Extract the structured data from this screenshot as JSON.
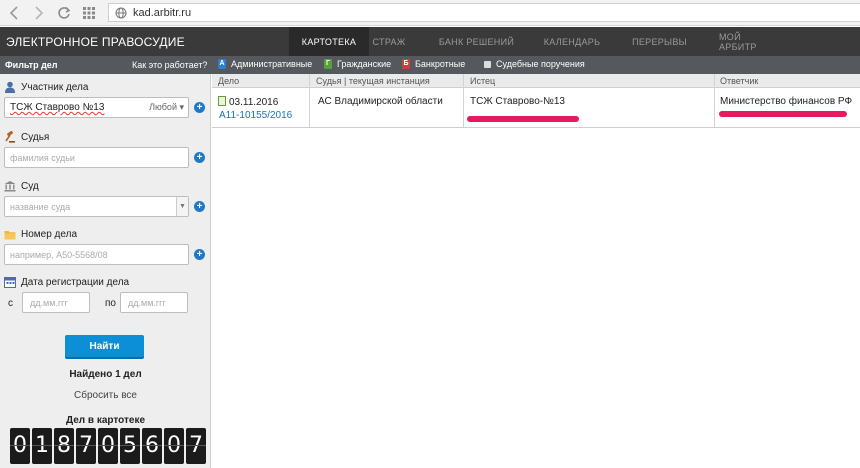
{
  "browser": {
    "url": "kad.arbitr.ru"
  },
  "header": {
    "logo": "ЭЛЕКТРОННОЕ ПРАВОСУДИЕ",
    "tabs": [
      {
        "label": "КАРТОТЕКА",
        "active": true
      },
      {
        "label": "СТРАЖ",
        "active": false
      },
      {
        "label": "БАНК РЕШЕНИЙ",
        "active": false
      },
      {
        "label": "КАЛЕНДАРЬ",
        "active": false
      },
      {
        "label": "ПЕРЕРЫВЫ",
        "active": false
      },
      {
        "label": "МОЙ АРБИТР",
        "active": false
      }
    ]
  },
  "filter_bar": {
    "title": "Фильтр дел",
    "how_it_works": "Как это работает?",
    "categories": [
      {
        "icon": "A",
        "label": "Административные",
        "color": "#2d7fd1"
      },
      {
        "icon": "Г",
        "label": "Гражданские",
        "color": "#5aa03a"
      },
      {
        "icon": "Б",
        "label": "Банкротные",
        "color": "#d33b3b"
      },
      {
        "icon": "",
        "label": "Судебные поручения",
        "color": "#dddddd"
      }
    ]
  },
  "sidebar": {
    "participant": {
      "label": "Участник дела",
      "value": "ТСЖ Ставрово №13",
      "role": "Любой"
    },
    "judge": {
      "label": "Судья",
      "placeholder": "фамилия судьи"
    },
    "court": {
      "label": "Суд",
      "placeholder": "название суда"
    },
    "case_number": {
      "label": "Номер дела",
      "placeholder": "например, А50-5568/08"
    },
    "reg_date": {
      "label": "Дата регистрации дела",
      "from_label": "с",
      "to_label": "по",
      "from_placeholder": "дд.мм.ггг",
      "to_placeholder": "дд.мм.ггг"
    },
    "search_button": "Найти",
    "found_text": "Найдено 1 дел",
    "reset_text": "Сбросить все",
    "counter_label": "Дел в картотеке",
    "counter_digits": [
      "0",
      "1",
      "8",
      "7",
      "0",
      "5",
      "6",
      "0",
      "7"
    ]
  },
  "table": {
    "columns": [
      "Дело",
      "Судья | текущая инстанция",
      "Истец",
      "Ответчик"
    ],
    "rows": [
      {
        "date": "03.11.2016",
        "case_number": "А11-10155/2016",
        "court": "АС Владимирской области",
        "plaintiff": "ТСЖ Ставрово-№13",
        "defendant": "Министерство финансов РФ"
      }
    ]
  }
}
